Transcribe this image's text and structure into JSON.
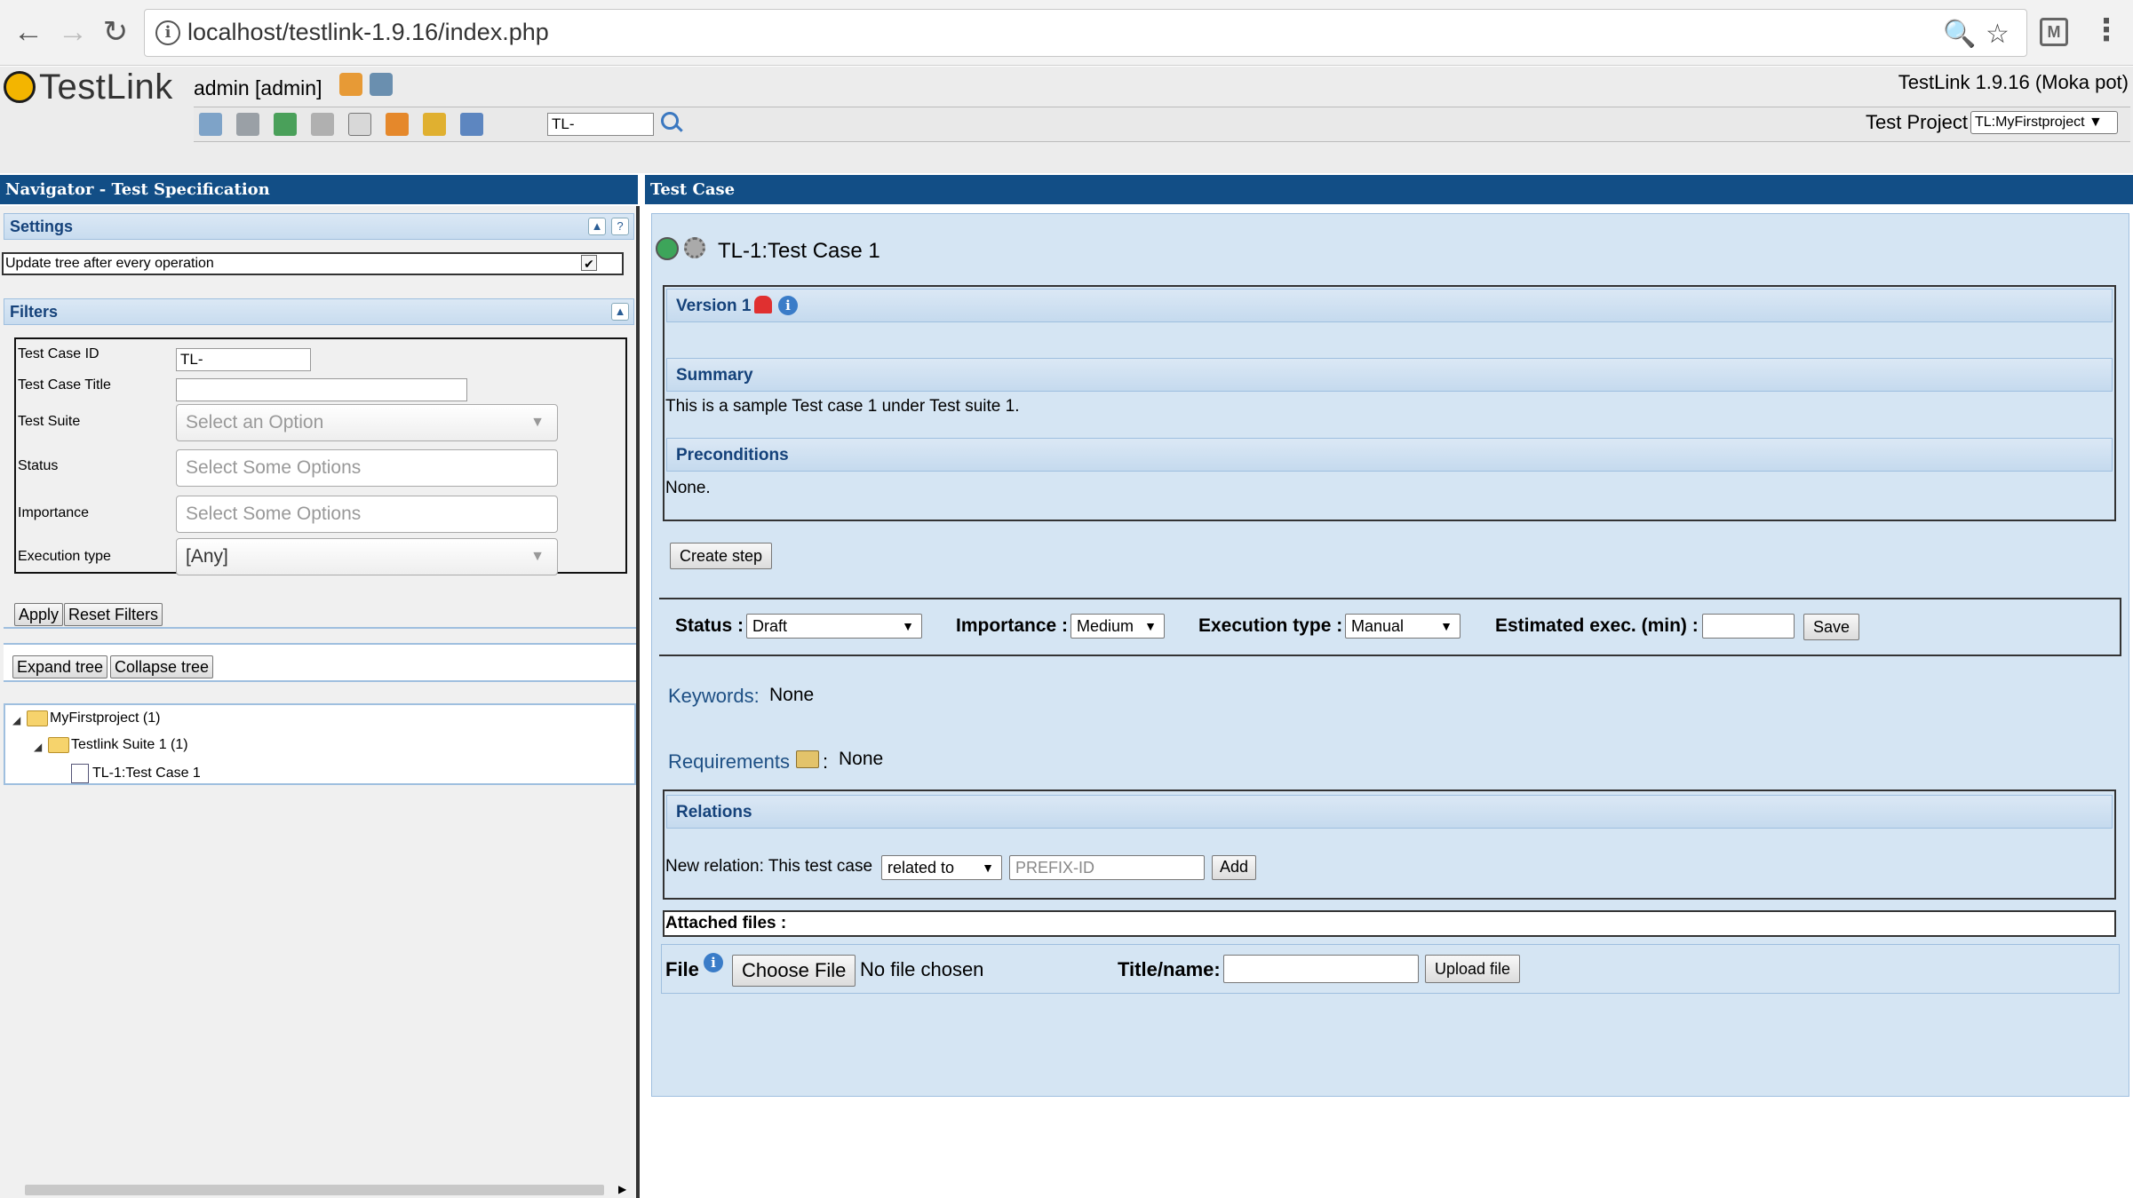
{
  "browser": {
    "url": "localhost/testlink-1.9.16/index.php",
    "back_icon": "←",
    "forward_icon": "→",
    "reload_icon": "↻",
    "info_icon": "i",
    "zoom_icon": "🔍",
    "star_icon": "☆",
    "ext_icon": "M",
    "menu_icon": "⋮"
  },
  "header": {
    "logo_text": "TestLink",
    "user": "admin [admin]",
    "version": "TestLink 1.9.16 (Moka pot)",
    "search_value": "TL-",
    "project_label": "Test Project",
    "project_value": "TL:MyFirstproject ▼"
  },
  "navigator": {
    "title": "Navigator - Test Specification",
    "settings_label": "Settings",
    "settings_option": "Update tree after every operation",
    "settings_checked": "✔",
    "collapse_btn": "▲",
    "help_btn": "?",
    "filters_label": "Filters",
    "filters": {
      "tc_id_label": "Test Case ID",
      "tc_id_value": "TL-",
      "tc_title_label": "Test Case Title",
      "tc_title_value": "",
      "suite_label": "Test Suite",
      "suite_value": "Select an Option",
      "status_label": "Status",
      "status_value": "Select Some Options",
      "importance_label": "Importance",
      "importance_value": "Select Some Options",
      "exec_type_label": "Execution type",
      "exec_type_value": "[Any]"
    },
    "apply_btn": "Apply",
    "reset_btn": "Reset Filters",
    "expand_btn": "Expand tree",
    "collapse_tree_btn": "Collapse tree",
    "tree": {
      "project": "MyFirstproject (1)",
      "suite": "Testlink Suite 1 (1)",
      "testcase": "TL-1:Test Case 1"
    }
  },
  "testcase": {
    "panel_title": "Test Case",
    "title": "TL-1:Test Case 1",
    "version_label": "Version 1",
    "summary_label": "Summary",
    "summary_text": "This is a sample Test case 1 under Test suite 1.",
    "preconditions_label": "Preconditions",
    "preconditions_text": "None.",
    "create_step_btn": "Create step",
    "status_label": "Status :",
    "status_value": "Draft",
    "importance_label": "Importance :",
    "importance_value": "Medium",
    "exec_type_label": "Execution type :",
    "exec_type_value": "Manual",
    "est_exec_label": "Estimated exec. (min) :",
    "save_btn": "Save",
    "keywords_label": "Keywords:",
    "keywords_value": "None",
    "requirements_label": "Requirements",
    "requirements_colon": ":",
    "requirements_value": "None",
    "relations_label": "Relations",
    "new_relation_label": "New relation: This test case",
    "relation_type": "related to",
    "relation_placeholder": "PREFIX-ID",
    "add_btn": "Add",
    "attached_files_label": "Attached files :",
    "file_label": "File",
    "choose_file_btn": "Choose File",
    "no_file_text": "No file chosen",
    "title_name_label": "Title/name:",
    "upload_btn": "Upload file"
  }
}
